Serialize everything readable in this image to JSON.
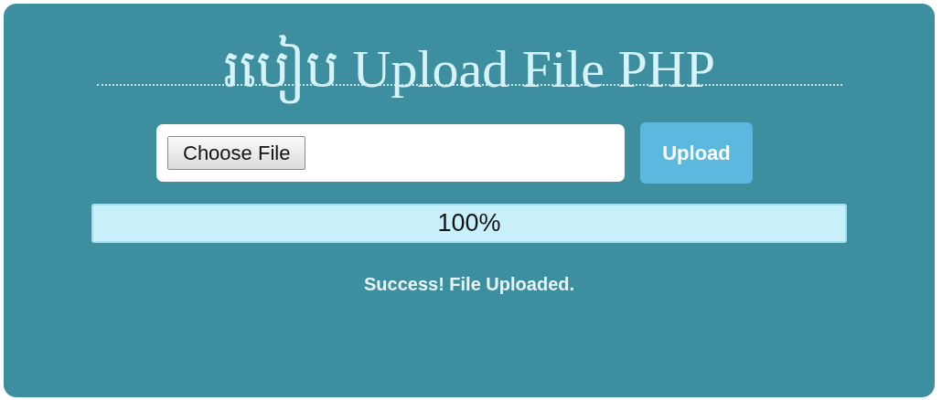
{
  "title": "របៀប Upload File PHP",
  "file_input": {
    "button_label": "Choose File"
  },
  "upload_button": {
    "label": "Upload"
  },
  "progress": {
    "level": 1,
    "reading": "100%"
  },
  "status_message": "Success! File Uploaded."
}
